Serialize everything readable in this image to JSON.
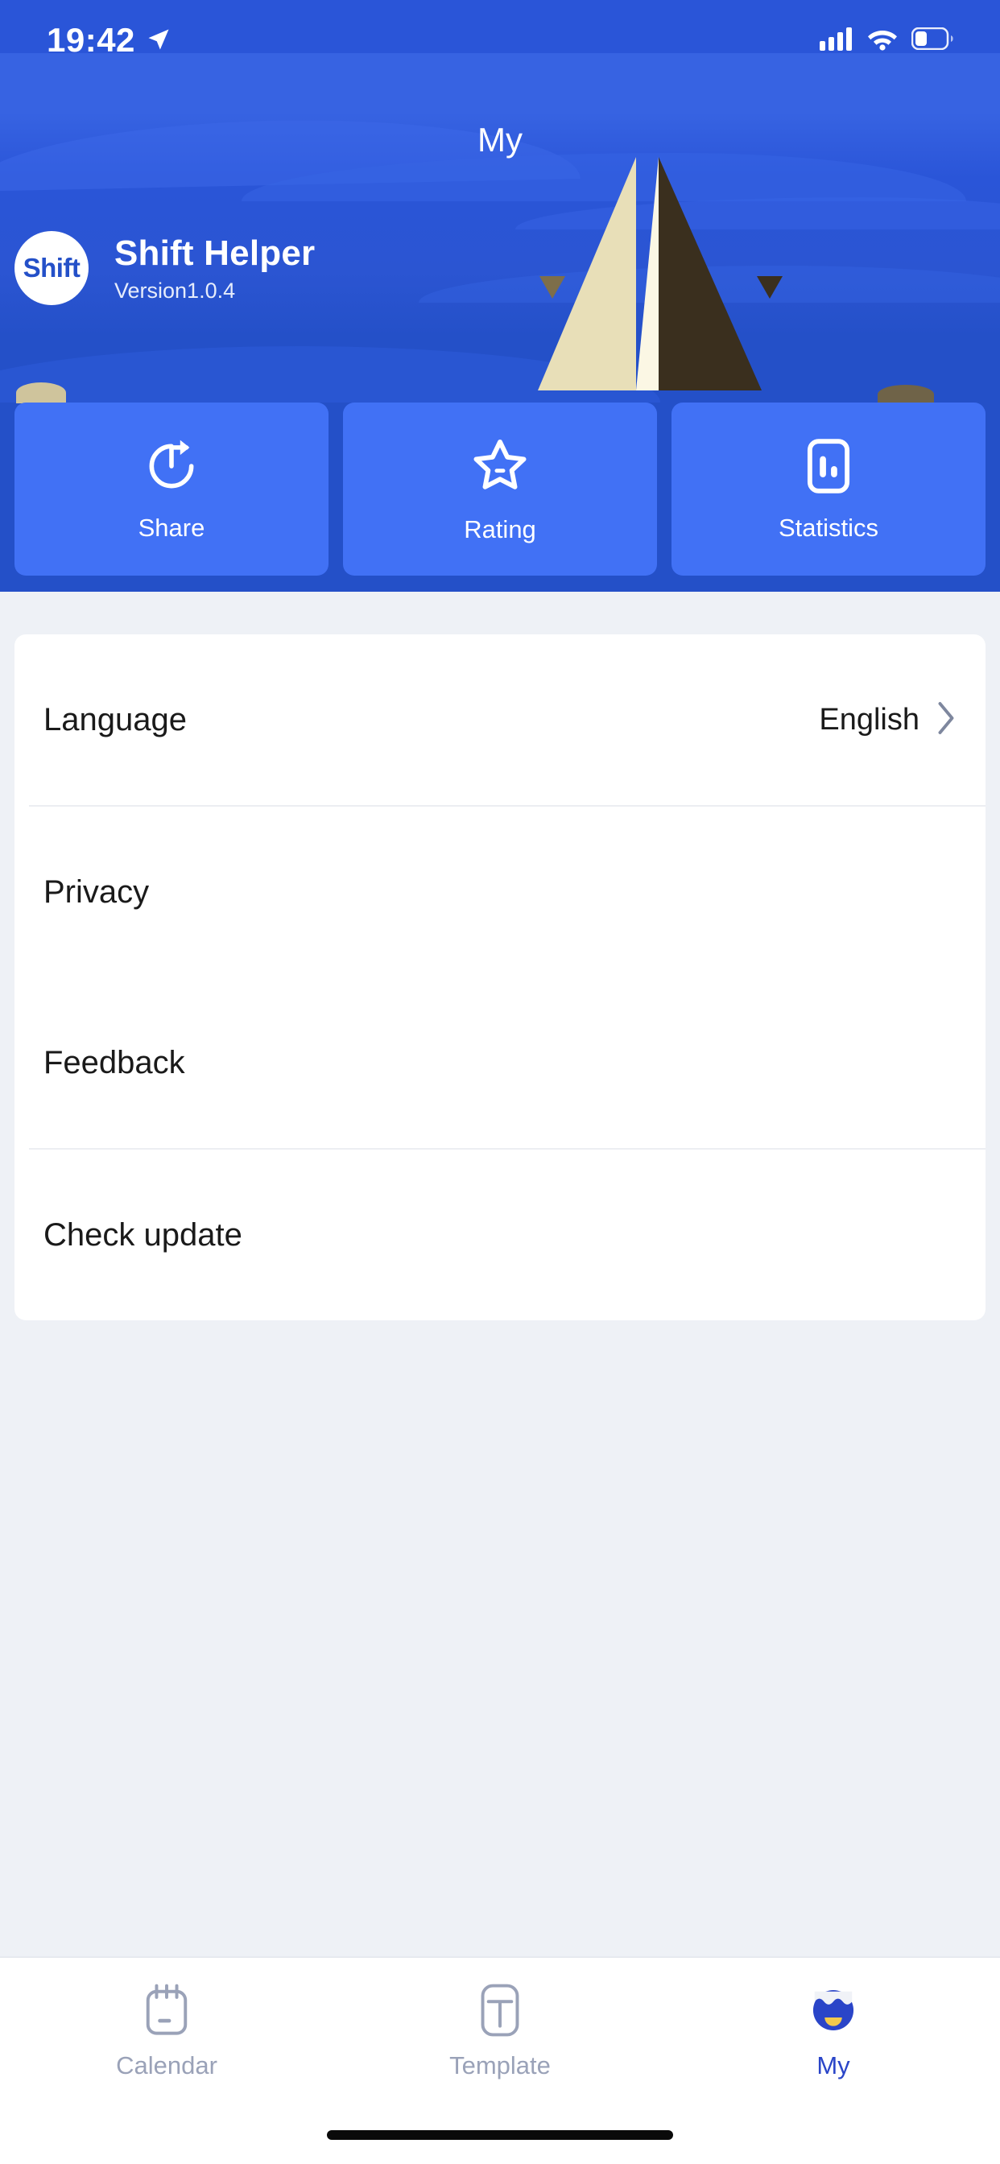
{
  "status_bar": {
    "time": "19:42",
    "location_icon": "location-arrow-icon",
    "signal_icon": "cellular-signal-icon",
    "wifi_icon": "wifi-icon",
    "battery_icon": "battery-icon"
  },
  "header": {
    "title": "My",
    "background_color": "#2450C8",
    "decoration": "pyramid-illustration"
  },
  "app": {
    "logo_text": "Shift",
    "name": "Shift Helper",
    "version": "Version1.0.4"
  },
  "actions": {
    "button_color": "#4171F5",
    "items": [
      {
        "label": "Share",
        "icon": "share-refresh-icon"
      },
      {
        "label": "Rating",
        "icon": "star-icon"
      },
      {
        "label": "Statistics",
        "icon": "bar-chart-icon"
      }
    ]
  },
  "settings": {
    "rows": [
      {
        "label": "Language",
        "value": "English",
        "chevron": true
      },
      {
        "label": "Privacy",
        "value": "",
        "chevron": false
      },
      {
        "label": "Feedback",
        "value": "",
        "chevron": false
      },
      {
        "label": "Check update",
        "value": "",
        "chevron": false
      }
    ]
  },
  "tabbar": {
    "active_color": "#2A45C8",
    "inactive_color": "#9AA2B8",
    "items": [
      {
        "label": "Calendar",
        "icon": "calendar-icon",
        "active": false
      },
      {
        "label": "Template",
        "icon": "template-icon",
        "active": false
      },
      {
        "label": "My",
        "icon": "profile-icon",
        "active": true
      }
    ]
  }
}
